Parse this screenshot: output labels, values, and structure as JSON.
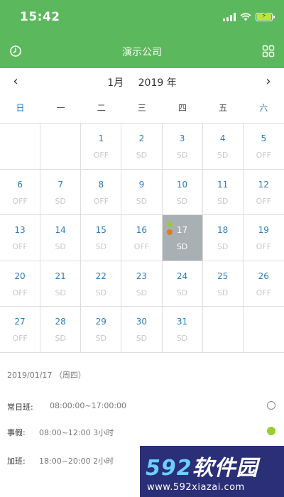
{
  "status_bar": {
    "time": "15:42"
  },
  "nav": {
    "title": "演示公司",
    "left_icon": "refresh-icon",
    "right_icon": "grid-icon"
  },
  "calendar": {
    "month": "1月",
    "year": "2019 年",
    "prev": "‹",
    "next": "›",
    "weekdays": [
      "日",
      "一",
      "二",
      "三",
      "四",
      "五",
      "六"
    ],
    "weeks": [
      [
        {
          "day": "",
          "shift": ""
        },
        {
          "day": "",
          "shift": ""
        },
        {
          "day": "1",
          "shift": "OFF"
        },
        {
          "day": "2",
          "shift": "SD"
        },
        {
          "day": "3",
          "shift": "SD"
        },
        {
          "day": "4",
          "shift": "SD"
        },
        {
          "day": "5",
          "shift": "OFF"
        }
      ],
      [
        {
          "day": "6",
          "shift": "OFF"
        },
        {
          "day": "7",
          "shift": "SD"
        },
        {
          "day": "8",
          "shift": "OFF"
        },
        {
          "day": "9",
          "shift": "SD"
        },
        {
          "day": "10",
          "shift": "SD"
        },
        {
          "day": "11",
          "shift": "SD"
        },
        {
          "day": "12",
          "shift": "OFF"
        }
      ],
      [
        {
          "day": "13",
          "shift": "OFF"
        },
        {
          "day": "14",
          "shift": "SD"
        },
        {
          "day": "15",
          "shift": "SD"
        },
        {
          "day": "16",
          "shift": "OFF"
        },
        {
          "day": "17",
          "shift": "SD"
        },
        {
          "day": "18",
          "shift": "SD"
        },
        {
          "day": "19",
          "shift": "OFF"
        }
      ],
      [
        {
          "day": "20",
          "shift": "OFF"
        },
        {
          "day": "21",
          "shift": "SD"
        },
        {
          "day": "22",
          "shift": "SD"
        },
        {
          "day": "23",
          "shift": "SD"
        },
        {
          "day": "24",
          "shift": "SD"
        },
        {
          "day": "25",
          "shift": "SD"
        },
        {
          "day": "26",
          "shift": "OFF"
        }
      ],
      [
        {
          "day": "27",
          "shift": "OFF"
        },
        {
          "day": "28",
          "shift": "SD"
        },
        {
          "day": "29",
          "shift": "SD"
        },
        {
          "day": "30",
          "shift": "SD"
        },
        {
          "day": "31",
          "shift": "SD"
        },
        {
          "day": "",
          "shift": ""
        },
        {
          "day": "",
          "shift": ""
        }
      ]
    ],
    "selected_day": "17",
    "selected_dots": [
      "#99cc33",
      "#e07b22"
    ]
  },
  "detail": {
    "date": "2019/01/17  （周四）",
    "rows": [
      {
        "label": "常日班:",
        "value": "08:00:00~17:00:00",
        "indicator": "empty"
      },
      {
        "label": "事假:",
        "value": "08:00~12:00 3小时",
        "indicator": "filled"
      },
      {
        "label": "加班:",
        "value": "18:00~20:00 2小时",
        "indicator": "none"
      }
    ]
  },
  "watermark": {
    "brand": "592软件园",
    "url": "www.592xiazai.com"
  },
  "colors": {
    "header": "#5cb85c",
    "day_text": "#2b7bb9",
    "selected_bg": "#a9b0b3",
    "dot_green": "#99cc33",
    "dot_orange": "#e07b22"
  }
}
